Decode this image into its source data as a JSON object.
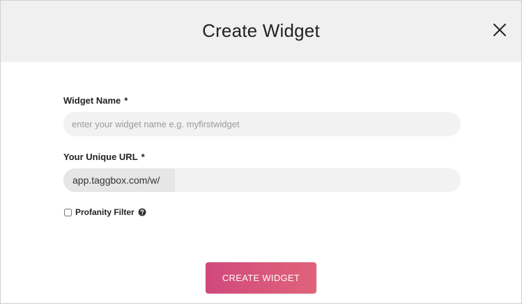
{
  "modal": {
    "title": "Create Widget",
    "close_icon": "close-icon"
  },
  "form": {
    "widget_name": {
      "label": "Widget Name",
      "required_marker": "*",
      "placeholder": "enter your widget name e.g. myfirstwidget",
      "value": ""
    },
    "unique_url": {
      "label": "Your Unique URL",
      "required_marker": "*",
      "prefix": "app.taggbox.com/w/",
      "value": ""
    },
    "profanity_filter": {
      "label": "Profanity Filter",
      "checked": false,
      "help_icon": "question-circle-icon"
    },
    "submit_label": "CREATE WIDGET"
  },
  "colors": {
    "header_bg": "#f0f0f0",
    "button_gradient_start": "#d1497c",
    "button_gradient_end": "#e0637a",
    "input_bg": "#f2f2f2"
  }
}
